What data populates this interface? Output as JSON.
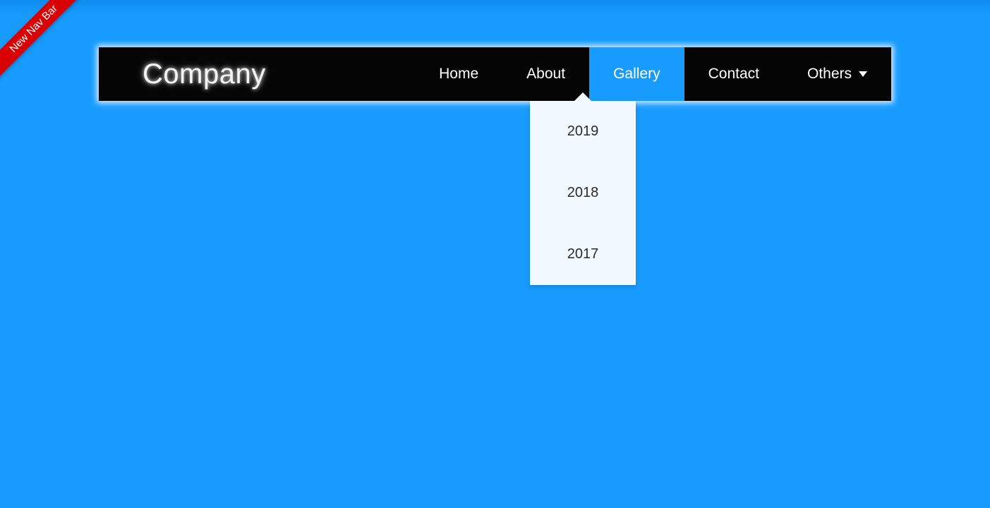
{
  "ribbon": {
    "label": "New Nav Bar"
  },
  "brand": {
    "name": "Company"
  },
  "nav": {
    "home": {
      "label": "Home"
    },
    "about": {
      "label": "About"
    },
    "gallery": {
      "label": "Gallery",
      "active": true
    },
    "contact": {
      "label": "Contact"
    },
    "others": {
      "label": "Others"
    }
  },
  "gallery_dropdown": {
    "items": [
      {
        "label": "2019"
      },
      {
        "label": "2018"
      },
      {
        "label": "2017"
      }
    ]
  }
}
